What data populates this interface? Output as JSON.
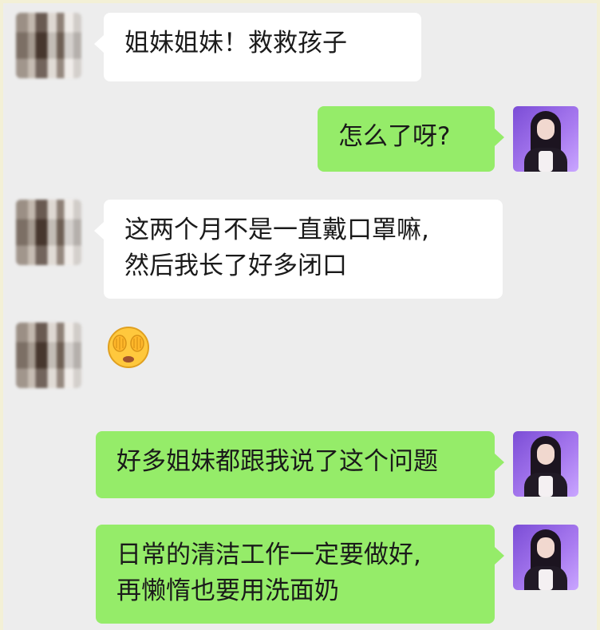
{
  "colors": {
    "background": "#ededed",
    "bubble_incoming": "#ffffff",
    "bubble_outgoing": "#95ec69",
    "outgoing_avatar": "#8a5ee0"
  },
  "messages": [
    {
      "sender": "friend",
      "lines": [
        "姐妹姐妹！救救孩子"
      ]
    },
    {
      "sender": "me",
      "lines": [
        "怎么了呀?"
      ]
    },
    {
      "sender": "friend",
      "lines": [
        "这两个月不是一直戴口罩嘛,",
        "然后我长了好多闭口"
      ]
    },
    {
      "sender": "friend",
      "emoji": "covering-face-emoji"
    },
    {
      "sender": "me",
      "lines": [
        "好多姐妹都跟我说了这个问题"
      ]
    },
    {
      "sender": "me",
      "lines": [
        "日常的清洁工作一定要做好,",
        "再懒惰也要用洗面奶"
      ]
    }
  ]
}
